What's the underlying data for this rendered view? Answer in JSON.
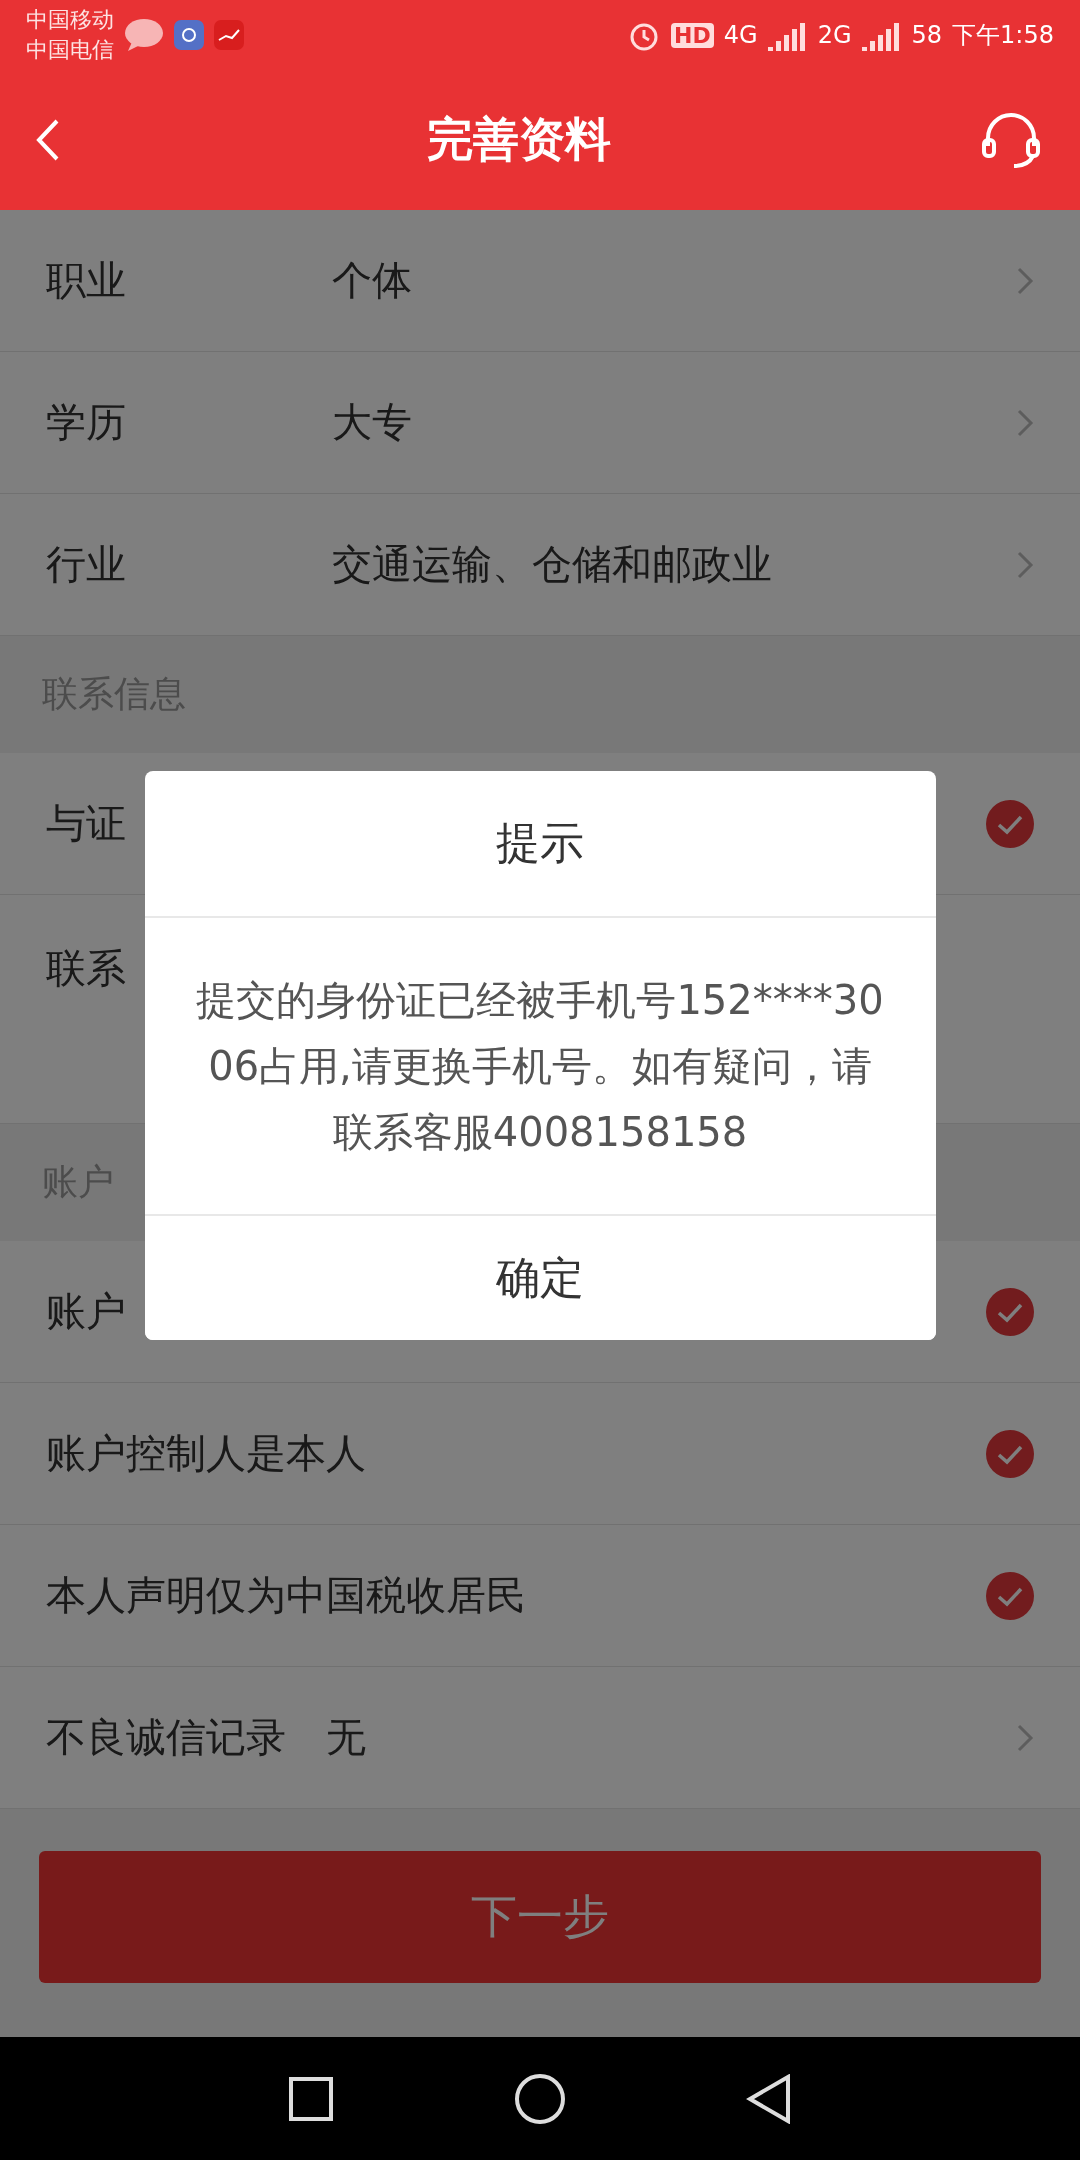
{
  "status_bar": {
    "carriers": [
      "中国移动",
      "中国电信"
    ],
    "hd": "HD",
    "sim1": "4G",
    "sim2": "2G",
    "battery": "58",
    "time": "下午1:58"
  },
  "header": {
    "title": "完善资料"
  },
  "sections": [
    {
      "rows": [
        {
          "kind": "select",
          "label": "职业",
          "value": "个体"
        },
        {
          "kind": "select",
          "label": "学历",
          "value": "大专"
        },
        {
          "kind": "select",
          "label": "行业",
          "value": "交通运输、仓储和邮政业"
        }
      ]
    },
    {
      "title": "联系信息",
      "rows": [
        {
          "kind": "check",
          "label": "与证",
          "checked": true
        },
        {
          "kind": "tall",
          "label": "联系"
        }
      ]
    },
    {
      "title": "账户",
      "rows": [
        {
          "kind": "check",
          "label": "账户",
          "checked": true
        },
        {
          "kind": "check",
          "label": "账户控制人是本人",
          "checked": true
        },
        {
          "kind": "check",
          "label": "本人声明仅为中国税收居民",
          "checked": true
        },
        {
          "kind": "inline",
          "label": "不良诚信记录",
          "value": "无"
        }
      ]
    }
  ],
  "next_button": "下一步",
  "dialog": {
    "title": "提示",
    "message": "提交的身份证已经被手机号152****3006占用,请更换手机号。如有疑问，请联系客服4008158158",
    "confirm": "确定"
  }
}
